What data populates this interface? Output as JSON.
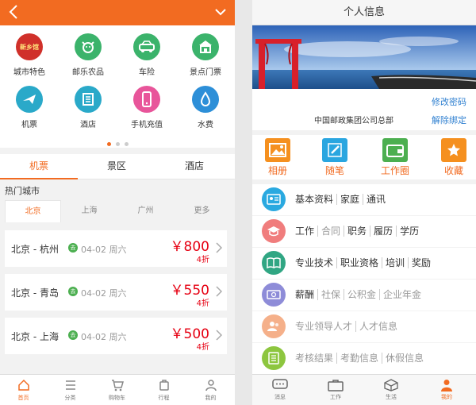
{
  "left": {
    "grid": [
      {
        "label": "城市特色",
        "icon": "city-special-icon",
        "color": "#d0302a",
        "logo": "新乡馆"
      },
      {
        "label": "邮乐农品",
        "icon": "cow-icon",
        "color": "#3bb36b"
      },
      {
        "label": "车险",
        "icon": "car-icon",
        "color": "#3bb36b"
      },
      {
        "label": "景点门票",
        "icon": "temple-icon",
        "color": "#3bb36b"
      },
      {
        "label": "机票",
        "icon": "airplane-icon",
        "color": "#2aa9c9"
      },
      {
        "label": "酒店",
        "icon": "hotel-icon",
        "color": "#2aa9c9"
      },
      {
        "label": "手机充值",
        "icon": "phone-icon",
        "color": "#e8559a"
      },
      {
        "label": "水费",
        "icon": "water-drop-icon",
        "color": "#2d8fd8"
      }
    ],
    "tabs": [
      "机票",
      "景区",
      "酒店"
    ],
    "hot_title": "热门城市",
    "cities": [
      "北京",
      "上海",
      "广州",
      "更多"
    ],
    "go_badge": "去",
    "routes": [
      {
        "name": "北京 - 杭州",
        "date": "04-02 周六",
        "price": "￥800",
        "discount": "4折"
      },
      {
        "name": "北京 - 青岛",
        "date": "04-02 周六",
        "price": "￥550",
        "discount": "4折"
      },
      {
        "name": "北京 - 上海",
        "date": "04-02 周六",
        "price": "￥500",
        "discount": "4折"
      }
    ],
    "nav": [
      "首页",
      "分类",
      "购物车",
      "行程",
      "我的"
    ]
  },
  "right": {
    "title": "个人信息",
    "org": "中国邮政集团公司总部",
    "change_pw": "修改密码",
    "unbind": "解除绑定",
    "quick": [
      {
        "label": "相册",
        "icon": "photo-album-icon",
        "color": "#f5901f"
      },
      {
        "label": "随笔",
        "icon": "pen-icon",
        "color": "#2aa6e0"
      },
      {
        "label": "工作圈",
        "icon": "wallet-icon",
        "color": "#4caf50"
      },
      {
        "label": "收藏",
        "icon": "star-icon",
        "color": "#f5901f"
      }
    ],
    "rows": [
      {
        "icon": "id-card-icon",
        "color": "#2aa9e0",
        "items": [
          "基本资料",
          "家庭",
          "通讯"
        ],
        "muted": []
      },
      {
        "icon": "graduation-cap-icon",
        "color": "#f07d7d",
        "items": [
          "工作",
          "合同",
          "职务",
          "履历",
          "学历"
        ],
        "muted": [
          "合同"
        ]
      },
      {
        "icon": "book-icon",
        "color": "#30a683",
        "items": [
          "专业技术",
          "职业资格",
          "培训",
          "奖励"
        ],
        "muted": []
      },
      {
        "icon": "money-icon",
        "color": "#8e8cd8",
        "items": [
          "薪酬",
          "社保",
          "公积金",
          "企业年金"
        ],
        "muted": [
          "社保",
          "公积金",
          "企业年金"
        ]
      },
      {
        "icon": "people-icon",
        "color": "#f5b08a",
        "items": [
          "专业领导人才",
          "人才信息"
        ],
        "muted": [
          "专业领导人才",
          "人才信息"
        ]
      },
      {
        "icon": "checklist-icon",
        "color": "#8dc63f",
        "items": [
          "考核结果",
          "考勤信息",
          "休假信息"
        ],
        "muted": [
          "考核结果",
          "考勤信息",
          "休假信息"
        ]
      }
    ],
    "nav": [
      "消息",
      "工作",
      "生活",
      "我的"
    ]
  }
}
